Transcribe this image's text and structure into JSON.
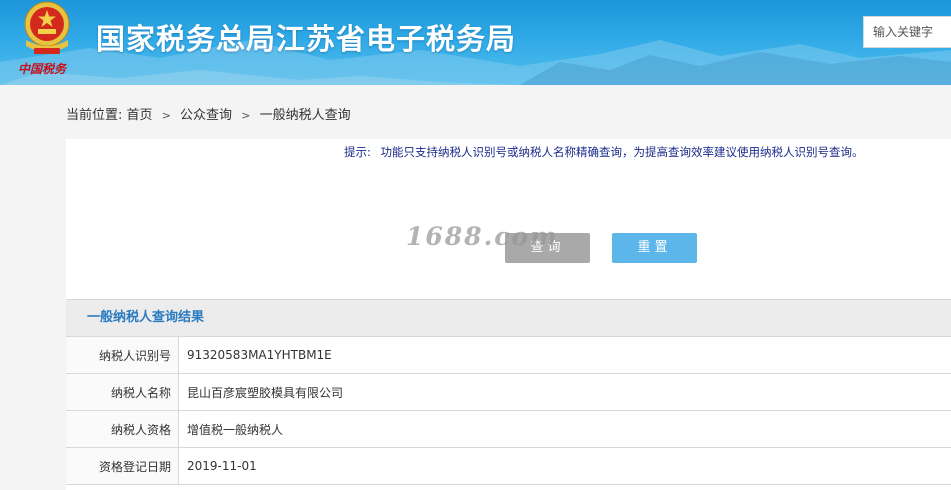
{
  "header": {
    "site_title": "国家税务总局江苏省电子税务局",
    "search_placeholder": "输入关键字",
    "emblem_text": "中国税务"
  },
  "breadcrumb": {
    "prefix": "当前位置:",
    "items": [
      "首页",
      "公众查询",
      "一般纳税人查询"
    ],
    "separator": ">"
  },
  "query": {
    "tip_label": "提示:",
    "tip_text": "功能只支持纳税人识别号或纳税人名称精确查询，为提高查询效率建议使用纳税人识别号查询。",
    "query_button": "查询",
    "reset_button": "重置"
  },
  "watermark": "1688.com",
  "result": {
    "title": "一般纳税人查询结果",
    "rows": [
      {
        "label": "纳税人识别号",
        "value": "91320583MA1YHTBM1E"
      },
      {
        "label": "纳税人名称",
        "value": "昆山百彦宸塑胶模具有限公司"
      },
      {
        "label": "纳税人资格",
        "value": "增值税一般纳税人"
      },
      {
        "label": "资格登记日期",
        "value": "2019-11-01"
      }
    ]
  },
  "colors": {
    "header_blue": "#2fa9e6",
    "tip_text": "#1a2b8a",
    "result_title": "#2a7bc0",
    "query_button": "#a9a9a9",
    "reset_button": "#5db6ea"
  }
}
